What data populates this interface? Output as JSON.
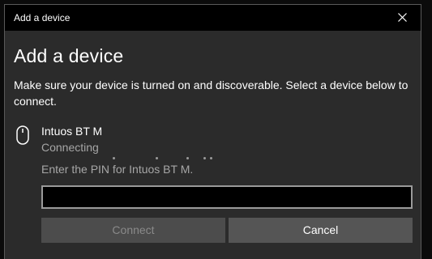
{
  "window": {
    "title": "Add a device"
  },
  "dialog": {
    "heading": "Add a device",
    "description": "Make sure your device is turned on and discoverable. Select a device below to connect."
  },
  "device": {
    "icon": "mouse-icon",
    "name": "Intuos BT M",
    "status": "Connecting"
  },
  "pin": {
    "label": "Enter the PIN for Intuos BT M.",
    "value": "",
    "placeholder": ""
  },
  "buttons": {
    "connect_label": "Connect",
    "connect_enabled": false,
    "cancel_label": "Cancel"
  },
  "colors": {
    "background": "#2b2b2b",
    "titlebar": "#000000",
    "text_primary": "#ffffff",
    "text_secondary": "#a6a6a6",
    "button_disabled": "#4c4c4c",
    "button": "#555555"
  }
}
